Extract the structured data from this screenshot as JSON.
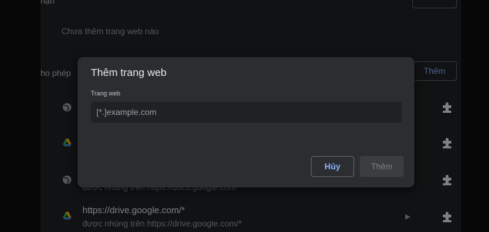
{
  "background": {
    "section_heading_partial": "hạn",
    "empty_text": "Chưa thêm trang web nào",
    "allow_heading_partial": "ho phép",
    "add_button_label": "Thêm",
    "rows": [
      {
        "icon": "globe-icon",
        "url": "",
        "sub": ""
      },
      {
        "icon": "google-drive-icon",
        "url": "",
        "sub": ""
      },
      {
        "icon": "globe-icon",
        "url": "",
        "sub": "được nhúng trên https://docs.google.com"
      },
      {
        "icon": "google-drive-icon",
        "url": "https://drive.google.com/*",
        "sub": "được nhúng trên https://drive.google.com/*"
      }
    ]
  },
  "dialog": {
    "title": "Thêm trang web",
    "field_label": "Trang web",
    "field_placeholder": "[*.]example.com",
    "cancel_label": "Hủy",
    "add_label": "Thêm"
  },
  "colors": {
    "accent": "#8ab4f8",
    "dialog_bg": "#2c2d31",
    "page_bg": "#202124"
  }
}
